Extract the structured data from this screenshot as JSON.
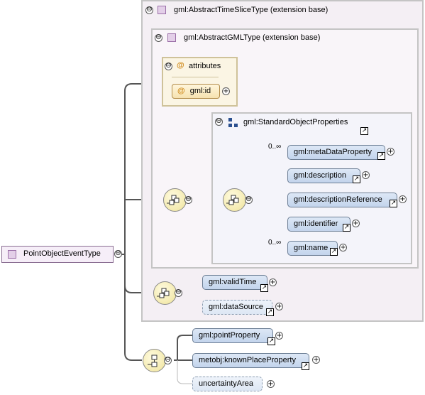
{
  "root": {
    "label": "PointObjectEventType",
    "icon": "complex-type-icon"
  },
  "outer_group": {
    "header": "gml:AbstractTimeSliceType (extension base)"
  },
  "inner_group": {
    "header": "gml:AbstractGMLType (extension base)"
  },
  "attributes": {
    "header": "attributes",
    "items": [
      {
        "label": "gml:id"
      }
    ]
  },
  "standard_props": {
    "header": "gml:StandardObjectProperties",
    "elements": [
      {
        "label": "gml:metaDataProperty",
        "multiplicity": "0..∞"
      },
      {
        "label": "gml:description"
      },
      {
        "label": "gml:descriptionReference"
      },
      {
        "label": "gml:identifier"
      },
      {
        "label": "gml:name",
        "multiplicity": "0..∞"
      }
    ]
  },
  "timeslice_elements": [
    {
      "label": "gml:validTime"
    },
    {
      "label": "gml:dataSource"
    }
  ],
  "own_elements": [
    {
      "label": "gml:pointProperty"
    },
    {
      "label": "metobj:knownPlaceProperty"
    },
    {
      "label": "uncertaintyArea"
    }
  ],
  "glyphs": {
    "collapse": "⊖",
    "expand": "+",
    "reference": "↗",
    "attribute": "@"
  }
}
